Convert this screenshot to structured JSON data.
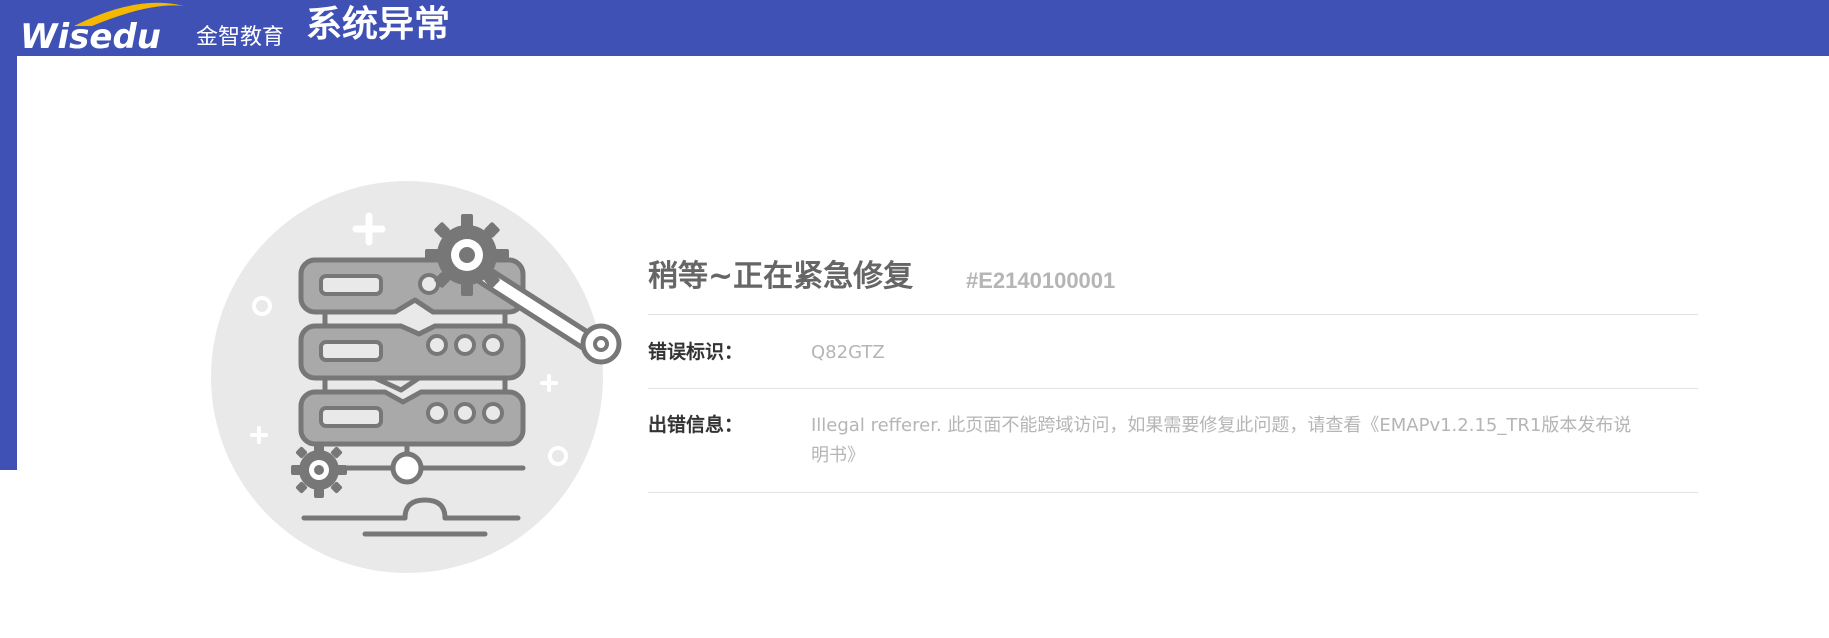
{
  "colors": {
    "header_blue": "#3f51b5",
    "logo_swoosh": "#f5b800",
    "illustration_circle": "#e9e9e9",
    "illustration_stroke": "#777777",
    "illustration_fill": "#a9a9a9",
    "text_dark": "#333333",
    "text_title": "#666666",
    "text_muted": "#b5b5b5",
    "divider": "#e2e2e2"
  },
  "header": {
    "logo_text": "Wisedu",
    "brand_cn": "金智教育",
    "title": "系统异常"
  },
  "illustration": {
    "icon": "broken-server-repair-icon"
  },
  "error": {
    "title": "稍等~正在紧急修复",
    "code": "#E2140100001",
    "rows": [
      {
        "label": "错误标识：",
        "value": "Q82GTZ"
      },
      {
        "label": "出错信息：",
        "value": "Illegal refferer. 此页面不能跨域访问，如果需要修复此问题，请查看《EMAPv1.2.15_TR1版本发布说明书》"
      }
    ]
  }
}
